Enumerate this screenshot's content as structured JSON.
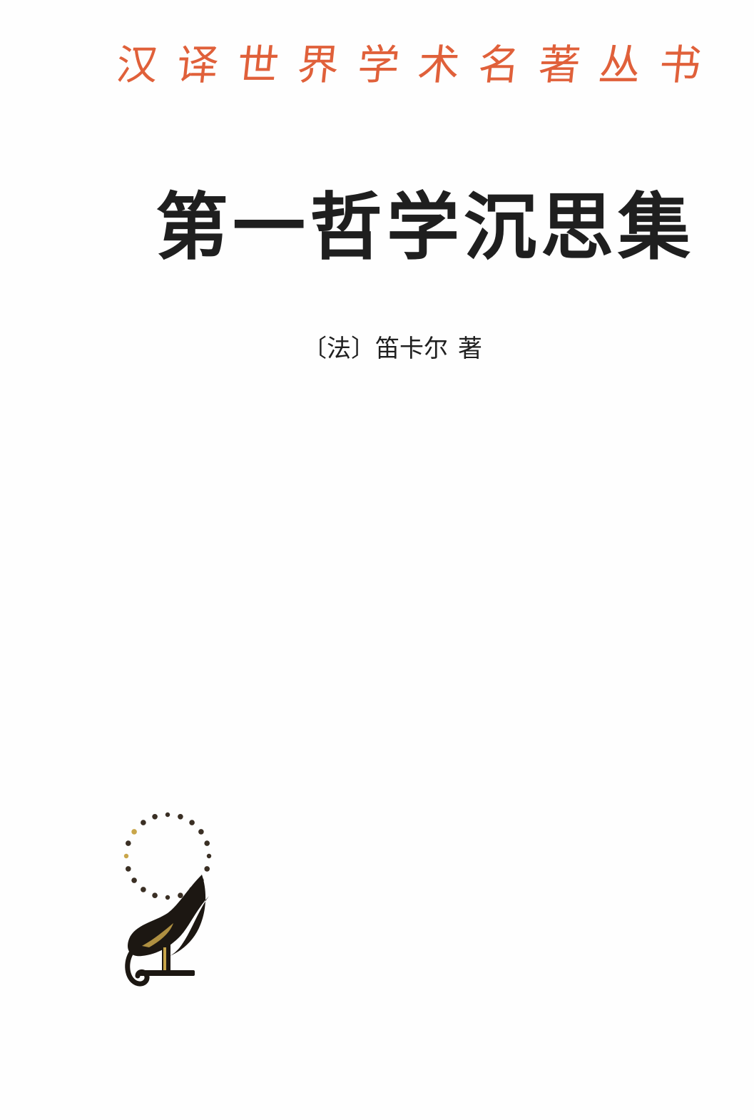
{
  "series": {
    "title_chars": [
      "汉",
      "译",
      "世",
      "界",
      "学",
      "术",
      "名",
      "著",
      "丛",
      "书"
    ],
    "color": "#e0603a"
  },
  "book": {
    "title": "第一哲学沉思集",
    "color": "#1f1f1f"
  },
  "author": {
    "nationality": "〔法〕",
    "name": "笛卡尔",
    "role": "著"
  },
  "logo": {
    "icon": "commercial-press-torch-logo",
    "dot_color": "#3a2f24",
    "accent_color": "#c9a64a"
  }
}
